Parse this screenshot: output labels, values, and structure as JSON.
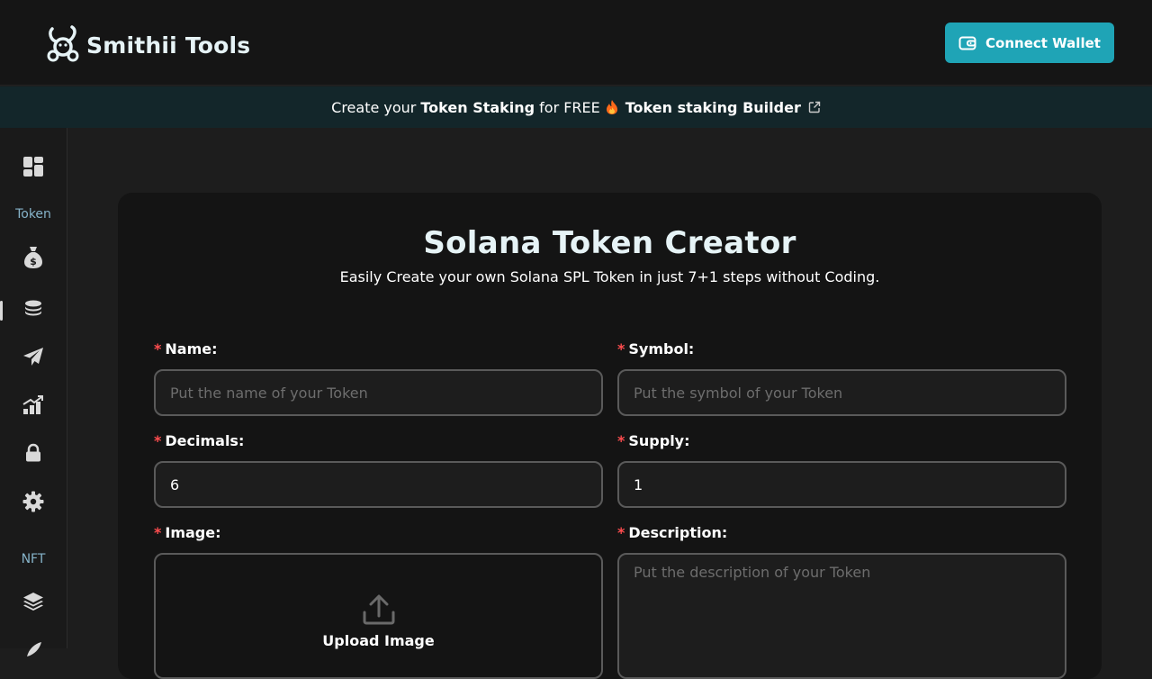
{
  "header": {
    "logo_text": "Smithii Tools",
    "connect_label": "Connect Wallet"
  },
  "banner": {
    "pre": "Create your",
    "bold1": "Token Staking",
    "mid": "for FREE",
    "bold2": "Token staking Builder"
  },
  "sidebar": {
    "section_token": "Token",
    "section_nft": "NFT",
    "icons": [
      "dashboard-icon",
      "money-bag-icon",
      "coins-stack-icon",
      "paper-plane-icon",
      "chart-growth-icon",
      "lock-icon",
      "gear-icon",
      "layers-icon"
    ]
  },
  "form": {
    "title": "Solana Token Creator",
    "subtitle": "Easily Create your own Solana SPL Token in just 7+1 steps without Coding.",
    "required_mark": "*",
    "name": {
      "label": "Name:",
      "placeholder": "Put the name of your Token",
      "value": ""
    },
    "symbol": {
      "label": "Symbol:",
      "placeholder": "Put the symbol of your Token",
      "value": ""
    },
    "decimals": {
      "label": "Decimals:",
      "value": "6"
    },
    "supply": {
      "label": "Supply:",
      "value": "1"
    },
    "image": {
      "label": "Image:",
      "upload_label": "Upload Image"
    },
    "description": {
      "label": "Description:",
      "placeholder": "Put the description of your Token"
    }
  },
  "colors": {
    "accent": "#1fa4b6",
    "banner_bg": "#13262a",
    "required": "#ff4d4f",
    "section_label": "#86b3c9"
  }
}
